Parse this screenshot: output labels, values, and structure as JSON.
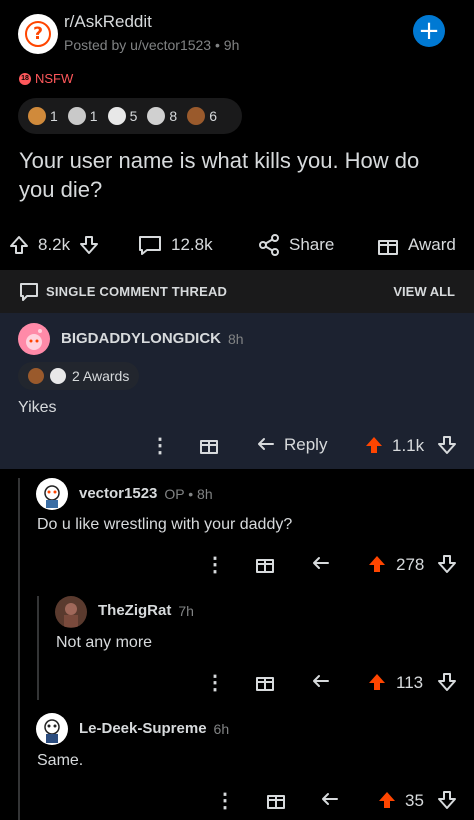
{
  "header": {
    "subreddit": "r/AskReddit",
    "posted_by": "Posted by u/vector1523 • 9h",
    "nsfw_label": "NSFW",
    "nsfw_badge": "18"
  },
  "post_awards": [
    {
      "icon": "helpful-award-icon",
      "count": "1",
      "color": "#d08a3b"
    },
    {
      "icon": "wholesome-award-icon",
      "count": "1",
      "color": "#c9c9c9"
    },
    {
      "icon": "ghost-award-icon",
      "count": "5",
      "color": "#e8e8e8"
    },
    {
      "icon": "silver-award-icon",
      "count": "8",
      "color": "#d0d0d0"
    },
    {
      "icon": "bear-award-icon",
      "count": "6",
      "color": "#9a5a2c"
    }
  ],
  "post": {
    "title": "Your user name is what kills you. How do you die?",
    "upvotes": "8.2k",
    "comments": "12.8k",
    "share": "Share",
    "award": "Award"
  },
  "thread_bar": {
    "label": "SINGLE COMMENT THREAD",
    "view_all": "VIEW ALL"
  },
  "comments": [
    {
      "author": "BIGDADDYLONGDICK",
      "meta": "8h",
      "awards_label": "2 Awards",
      "text": "Yikes",
      "reply": "Reply",
      "score": "1.1k"
    },
    {
      "author": "vector1523",
      "meta": "OP • 8h",
      "text": "Do u like wrestling with your daddy?",
      "score": "278"
    },
    {
      "author": "TheZigRat",
      "meta": "7h",
      "text": "Not any more",
      "score": "113"
    },
    {
      "author": "Le-Deek-Supreme",
      "meta": "6h",
      "text": "Same.",
      "score": "35"
    }
  ],
  "colors": {
    "accent": "#0079d3",
    "upvoted": "#ff4500",
    "nsfw": "#ff585b",
    "highlight_bg": "#1c2230"
  }
}
